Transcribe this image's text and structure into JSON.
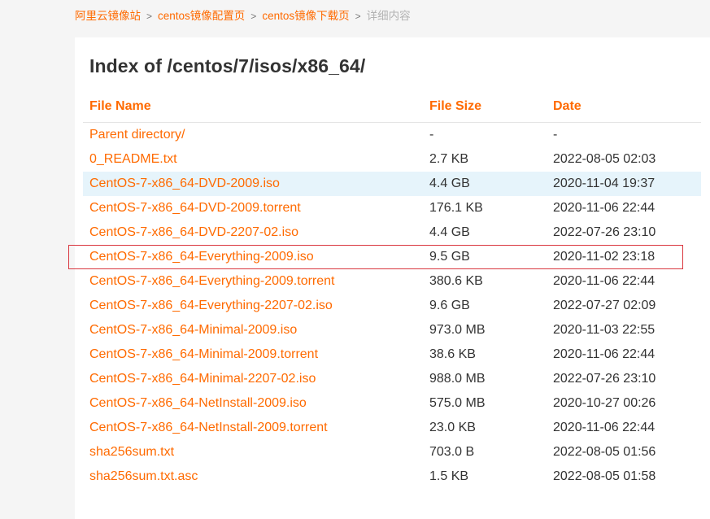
{
  "breadcrumb": {
    "home": "阿里云镜像站",
    "config": "centos镜像配置页",
    "download": "centos镜像下载页",
    "current": "详细内容",
    "separator": ">"
  },
  "page": {
    "title": "Index of /centos/7/isos/x86_64/"
  },
  "table": {
    "headers": {
      "name": "File Name",
      "size": "File Size",
      "date": "Date"
    },
    "rows": [
      {
        "name": "Parent directory/",
        "size": "-",
        "date": "-"
      },
      {
        "name": "0_README.txt",
        "size": "2.7 KB",
        "date": "2022-08-05 02:03"
      },
      {
        "name": "CentOS-7-x86_64-DVD-2009.iso",
        "size": "4.4 GB",
        "date": "2020-11-04 19:37"
      },
      {
        "name": "CentOS-7-x86_64-DVD-2009.torrent",
        "size": "176.1 KB",
        "date": "2020-11-06 22:44"
      },
      {
        "name": "CentOS-7-x86_64-DVD-2207-02.iso",
        "size": "4.4 GB",
        "date": "2022-07-26 23:10"
      },
      {
        "name": "CentOS-7-x86_64-Everything-2009.iso",
        "size": "9.5 GB",
        "date": "2020-11-02 23:18"
      },
      {
        "name": "CentOS-7-x86_64-Everything-2009.torrent",
        "size": "380.6 KB",
        "date": "2020-11-06 22:44"
      },
      {
        "name": "CentOS-7-x86_64-Everything-2207-02.iso",
        "size": "9.6 GB",
        "date": "2022-07-27 02:09"
      },
      {
        "name": "CentOS-7-x86_64-Minimal-2009.iso",
        "size": "973.0 MB",
        "date": "2020-11-03 22:55"
      },
      {
        "name": "CentOS-7-x86_64-Minimal-2009.torrent",
        "size": "38.6 KB",
        "date": "2020-11-06 22:44"
      },
      {
        "name": "CentOS-7-x86_64-Minimal-2207-02.iso",
        "size": "988.0 MB",
        "date": "2022-07-26 23:10"
      },
      {
        "name": "CentOS-7-x86_64-NetInstall-2009.iso",
        "size": "575.0 MB",
        "date": "2020-10-27 00:26"
      },
      {
        "name": "CentOS-7-x86_64-NetInstall-2009.torrent",
        "size": "23.0 KB",
        "date": "2020-11-06 22:44"
      },
      {
        "name": "sha256sum.txt",
        "size": "703.0 B",
        "date": "2022-08-05 01:56"
      },
      {
        "name": "sha256sum.txt.asc",
        "size": "1.5 KB",
        "date": "2022-08-05 01:58"
      }
    ]
  },
  "colors": {
    "accent": "#ff6a00",
    "text": "#333333",
    "hover_row": "#e6f4fb",
    "selection_outline": "#d9363e",
    "breadcrumb_current": "#b3b3b3",
    "page_background": "#f5f5f5"
  }
}
